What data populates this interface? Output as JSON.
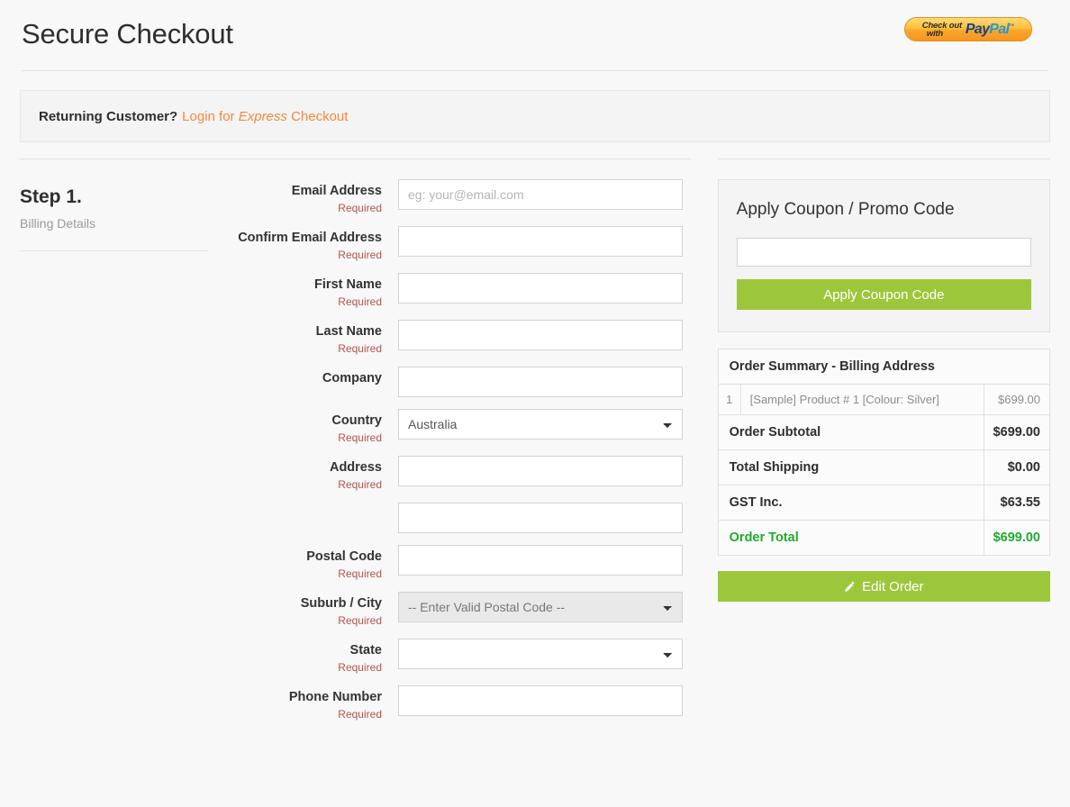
{
  "header": {
    "title": "Secure Checkout",
    "paypal": {
      "line1": "Check out",
      "line2": "with",
      "pay": "Pay",
      "pal": "Pal",
      "tm": "™"
    }
  },
  "returning": {
    "prompt": "Returning Customer?",
    "link_pre": "Login for ",
    "link_em": "Express",
    "link_post": " Checkout"
  },
  "step": {
    "title": "Step 1.",
    "subtitle": "Billing Details"
  },
  "form": {
    "required_text": "Required",
    "fields": [
      {
        "label": "Email Address",
        "required": "Required",
        "type": "text",
        "value": "",
        "placeholder": "eg: your@email.com"
      },
      {
        "label": "Confirm Email Address",
        "required": "Required",
        "type": "text",
        "value": "",
        "placeholder": ""
      },
      {
        "label": "First Name",
        "required": "Required",
        "type": "text",
        "value": "",
        "placeholder": ""
      },
      {
        "label": "Last Name",
        "required": "Required",
        "type": "text",
        "value": "",
        "placeholder": ""
      },
      {
        "label": "Company",
        "required": "",
        "type": "text",
        "value": "",
        "placeholder": ""
      },
      {
        "label": "Country",
        "required": "Required",
        "type": "select",
        "value": "Australia",
        "placeholder": ""
      },
      {
        "label": "Address",
        "required": "Required",
        "type": "text",
        "value": "",
        "placeholder": ""
      },
      {
        "label": "",
        "required": "",
        "type": "text",
        "value": "",
        "placeholder": ""
      },
      {
        "label": "Postal Code",
        "required": "Required",
        "type": "text",
        "value": "",
        "placeholder": ""
      },
      {
        "label": "Suburb / City",
        "required": "Required",
        "type": "select-disabled",
        "value": "-- Enter Valid Postal Code --",
        "placeholder": ""
      },
      {
        "label": "State",
        "required": "Required",
        "type": "select",
        "value": "",
        "placeholder": ""
      },
      {
        "label": "Phone Number",
        "required": "Required",
        "type": "text",
        "value": "",
        "placeholder": ""
      }
    ]
  },
  "coupon": {
    "title": "Apply Coupon / Promo Code",
    "input_value": "",
    "input_placeholder": "",
    "button_label": "Apply Coupon Code"
  },
  "order_summary": {
    "heading": "Order Summary - Billing Address",
    "product": {
      "qty": "1",
      "name": "[Sample] Product # 1 [Colour: Silver]",
      "amount": "$699.00"
    },
    "rows": [
      {
        "label": "Order Subtotal",
        "value": "$699.00"
      },
      {
        "label": "Total Shipping",
        "value": "$0.00"
      },
      {
        "label": "GST Inc.",
        "value": "$63.55"
      }
    ],
    "total": {
      "label": "Order Total",
      "value": "$699.00"
    },
    "edit_button": "Edit Order"
  },
  "colors": {
    "green": "#9dc73b",
    "total_green": "#22aa2e",
    "link_orange": "#f5893a",
    "required_red": "#b5534a"
  }
}
